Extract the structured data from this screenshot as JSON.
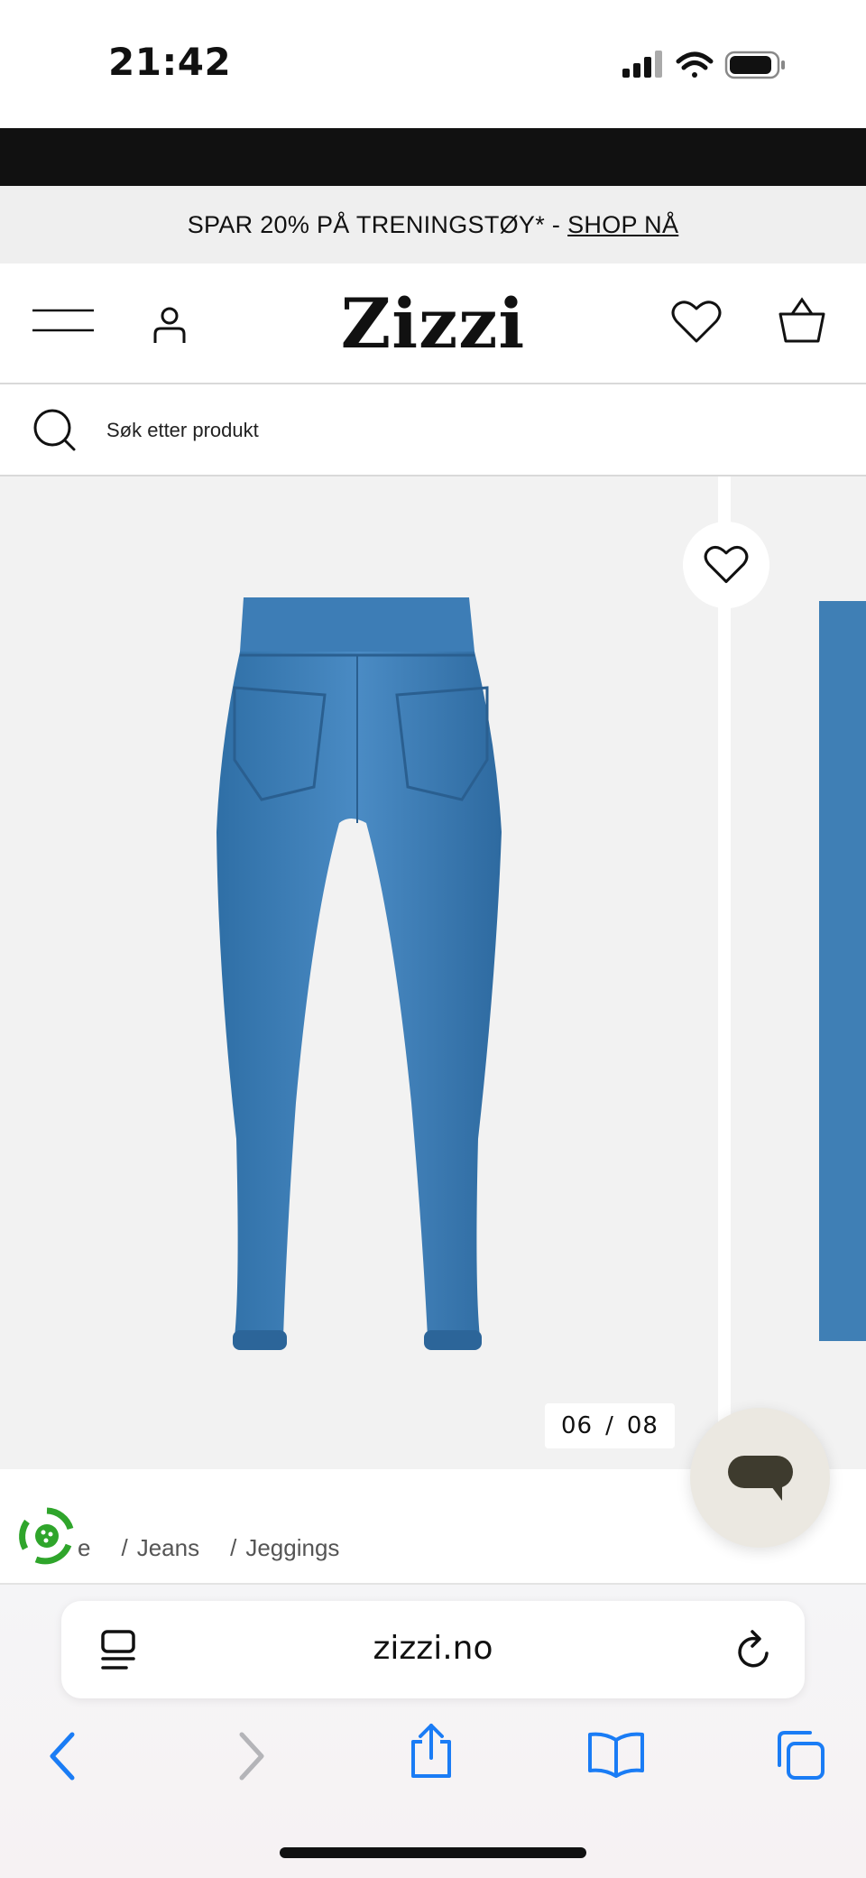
{
  "status_bar": {
    "time": "21:42",
    "icons": [
      "signal-icon",
      "wifi-icon",
      "battery-icon"
    ]
  },
  "promo": {
    "text": "SPAR 20% PÅ TRENINGSTØY* -",
    "link": "SHOP NÅ"
  },
  "header": {
    "logo": "Zizzi",
    "icons": [
      "menu-icon",
      "account-icon",
      "wishlist-icon",
      "cart-icon"
    ]
  },
  "search": {
    "placeholder": "Søk etter produkt"
  },
  "gallery": {
    "counter_current": "06",
    "counter_separator": "/",
    "counter_total": "08",
    "image_color": "#3f7fb5"
  },
  "breadcrumb": {
    "items": [
      "e",
      "Jeans",
      "Jeggings"
    ],
    "separator": "/"
  },
  "browser": {
    "url": "zizzi.no",
    "toolbar_icons": [
      "back-icon",
      "forward-icon",
      "share-icon",
      "bookmarks-icon",
      "tabs-icon"
    ],
    "accent": "#1a7cf5"
  },
  "colors": {
    "promo_bg": "#efefef",
    "gallery_bg": "#f2f2f2",
    "chat_bg": "#ebe8e1",
    "eco_green": "#2fa52b"
  }
}
